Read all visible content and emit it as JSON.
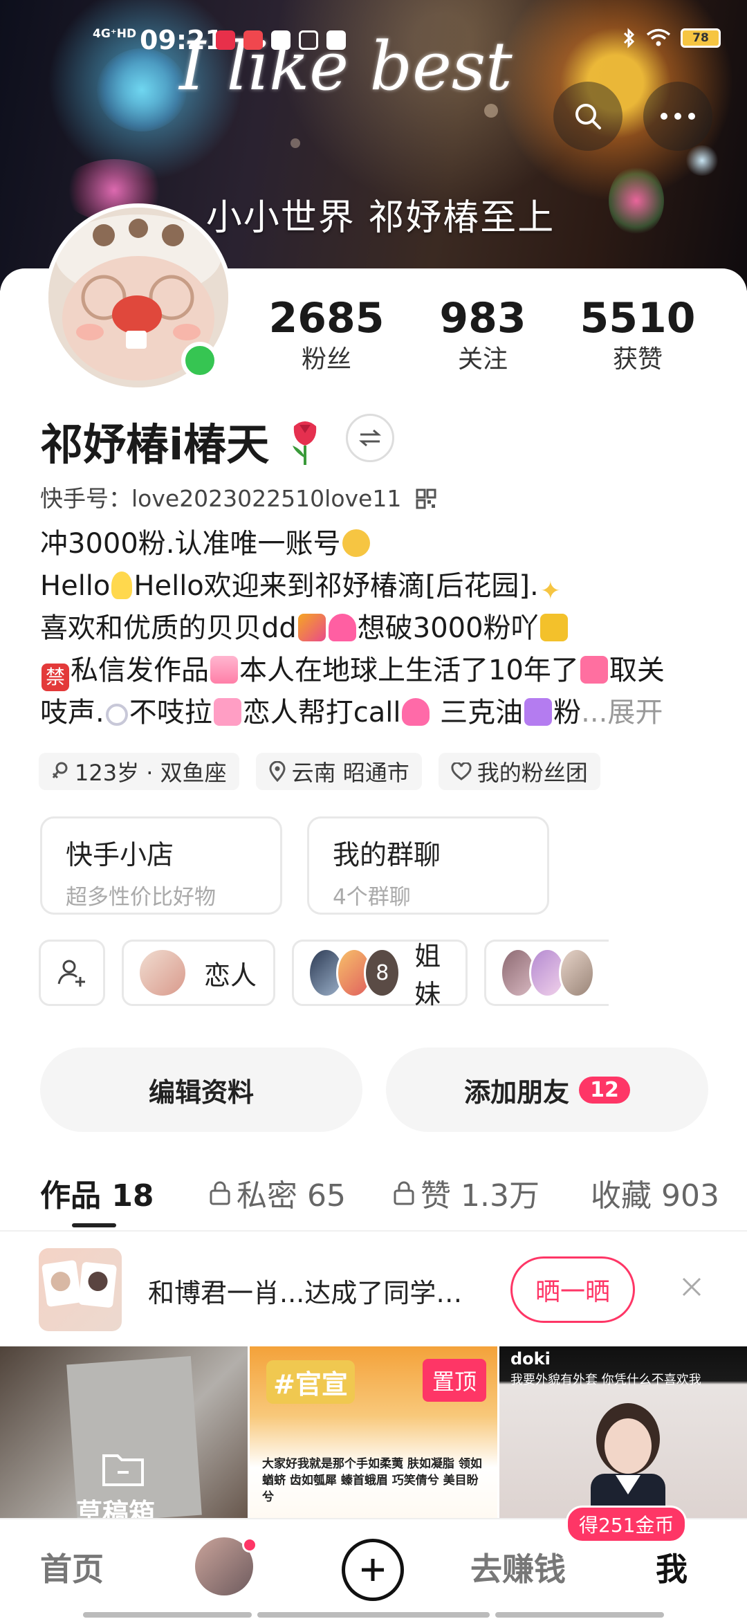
{
  "status_bar": {
    "network": "4G⁺HD",
    "time": "09:21",
    "battery": "78"
  },
  "banner": {
    "title": "I like best",
    "subtitle": "小小世界 祁妤椿至上"
  },
  "profile": {
    "name": "祁妤椿i椿天",
    "kuaishou_id": "快手号：love2023022510love11",
    "stats": [
      {
        "value": "2685",
        "label": "粉丝"
      },
      {
        "value": "983",
        "label": "关注"
      },
      {
        "value": "5510",
        "label": "获赞"
      }
    ],
    "bio": {
      "line1": "冲3000粉.认准唯一账号",
      "line2_a": "Hello",
      "line2_b": "Hello欢迎来到祁妤椿滴[后花园].",
      "line3_a": "喜欢和优质的贝贝dd",
      "line3_b": "想破3000粉吖",
      "line4_a": "私信发作品",
      "line4_b": "本人在地球上生活了10年了",
      "line4_c": "取关",
      "line5_a": "吱声.",
      "line5_b": "不吱拉",
      "line5_c": "恋人帮打call",
      "line5_d": "三克油",
      "line5_e": "粉",
      "more": "...展开",
      "ban_char": "禁"
    },
    "tags": [
      {
        "label": "123岁 · 双鱼座",
        "icon": "female-icon"
      },
      {
        "label": "云南 昭通市",
        "icon": "location-pin-icon"
      },
      {
        "label": "我的粉丝团",
        "icon": "fan-heart-icon"
      }
    ],
    "shortcuts": [
      {
        "title": "快手小店",
        "subtitle": "超多性价比好物"
      },
      {
        "title": "我的群聊",
        "subtitle": "4个群聊"
      }
    ],
    "groups": [
      {
        "label": "恋人"
      },
      {
        "label": "姐妹",
        "count": "8"
      }
    ],
    "actions": {
      "edit": "编辑资料",
      "add_friends": "添加朋友",
      "add_friends_badge": "12"
    }
  },
  "tabs": [
    {
      "label": "作品 18",
      "active": true
    },
    {
      "label": "私密 65",
      "locked": true
    },
    {
      "label": "赞 1.3万",
      "locked": true
    },
    {
      "label": "收藏 903"
    }
  ],
  "promo": {
    "text": "和博君一肖...达成了同学…",
    "button": "晒一晒"
  },
  "grid": {
    "cell1_label": "草稿箱",
    "cell2_pin": "置顶",
    "cell2_tag": "#官宣",
    "cell2_caption": "大家好我就是那个手如柔荑 肤如凝脂 领如蝤蛴 齿如瓠犀 螓首蛾眉 巧笑倩兮 美目盼兮",
    "cell3_brand": "doki",
    "cell3_caption": "我要外貌有外套 你凭什么不喜欢我"
  },
  "bottom_nav": {
    "home": "首页",
    "earn": "去赚钱",
    "coins": "得251金币",
    "me": "我"
  },
  "colors": {
    "accent": "#fe3666",
    "online": "#36c552"
  }
}
